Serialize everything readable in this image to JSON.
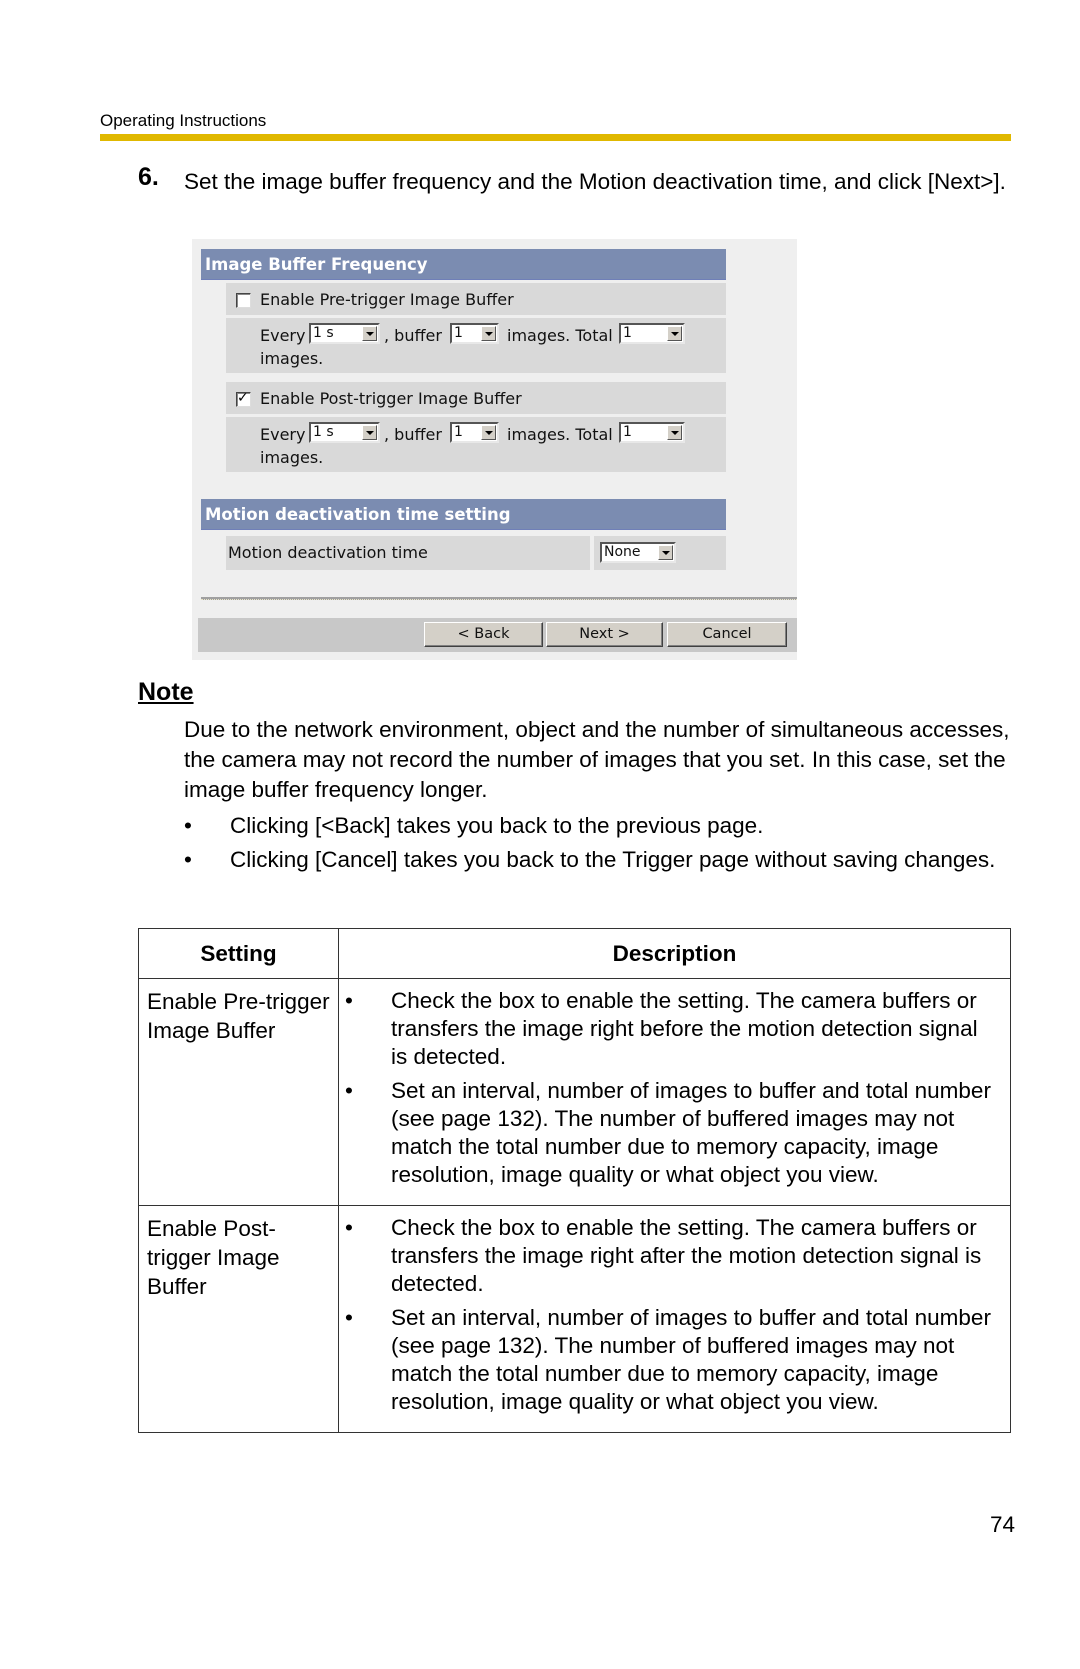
{
  "header": {
    "running_title": "Operating Instructions",
    "rule_color": "#e0b800"
  },
  "step": {
    "number": "6.",
    "text": "Set the image buffer frequency and the Motion deactivation time, and click [Next>]."
  },
  "ui_panel": {
    "section1": {
      "title": "Image Buffer Frequency",
      "header_color": "#7b8cb1",
      "pre_trigger": {
        "checkbox_label": "Enable Pre-trigger Image Buffer",
        "checked": false,
        "every_label": "Every",
        "every_value": "1 s",
        "buffer_label": ", buffer",
        "buffer_value": "1",
        "images_total_label": "images. Total",
        "total_value": "1",
        "images_label": "images."
      },
      "post_trigger": {
        "checkbox_label": "Enable Post-trigger Image Buffer",
        "checked": true,
        "check_glyph": "✓",
        "every_label": "Every",
        "every_value": "1 s",
        "buffer_label": ", buffer",
        "buffer_value": "1",
        "images_total_label": "images. Total",
        "total_value": "1",
        "images_label": "images."
      }
    },
    "section2": {
      "title": "Motion deactivation time setting",
      "row_label": "Motion deactivation time",
      "select_value": "None"
    },
    "buttons": {
      "back": "< Back",
      "next": "Next >",
      "cancel": "Cancel"
    }
  },
  "note": {
    "title": "Note",
    "paragraph": "Due to the network environment, object and the number of simultaneous accesses, the camera may not record the number of images that you set. In this case, set the image buffer frequency longer.",
    "bullet_glyph": "•",
    "bullets": [
      "Clicking [<Back] takes you back to the previous page.",
      "Clicking [Cancel] takes you back to the Trigger page without saving changes."
    ]
  },
  "table": {
    "headers": [
      "Setting",
      "Description"
    ],
    "rows": [
      {
        "setting": "Enable Pre-trigger Image Buffer",
        "items": [
          "Check the box to enable the setting. The camera buffers or transfers the image right before the motion detection signal is detected.",
          "Set an interval, number of images to buffer and total number (see page 132). The number of buffered images may not match the total number due to memory capacity, image resolution, image quality or what object you view."
        ]
      },
      {
        "setting": "Enable Post-trigger Image Buffer",
        "items": [
          "Check the box to enable the setting. The camera buffers or transfers the image right after the motion detection signal is detected.",
          "Set an interval, number of images to buffer and total number (see page 132). The number of buffered images may not match the total number due to memory capacity, image resolution, image quality or what object you view."
        ]
      }
    ]
  },
  "page_number": "74"
}
